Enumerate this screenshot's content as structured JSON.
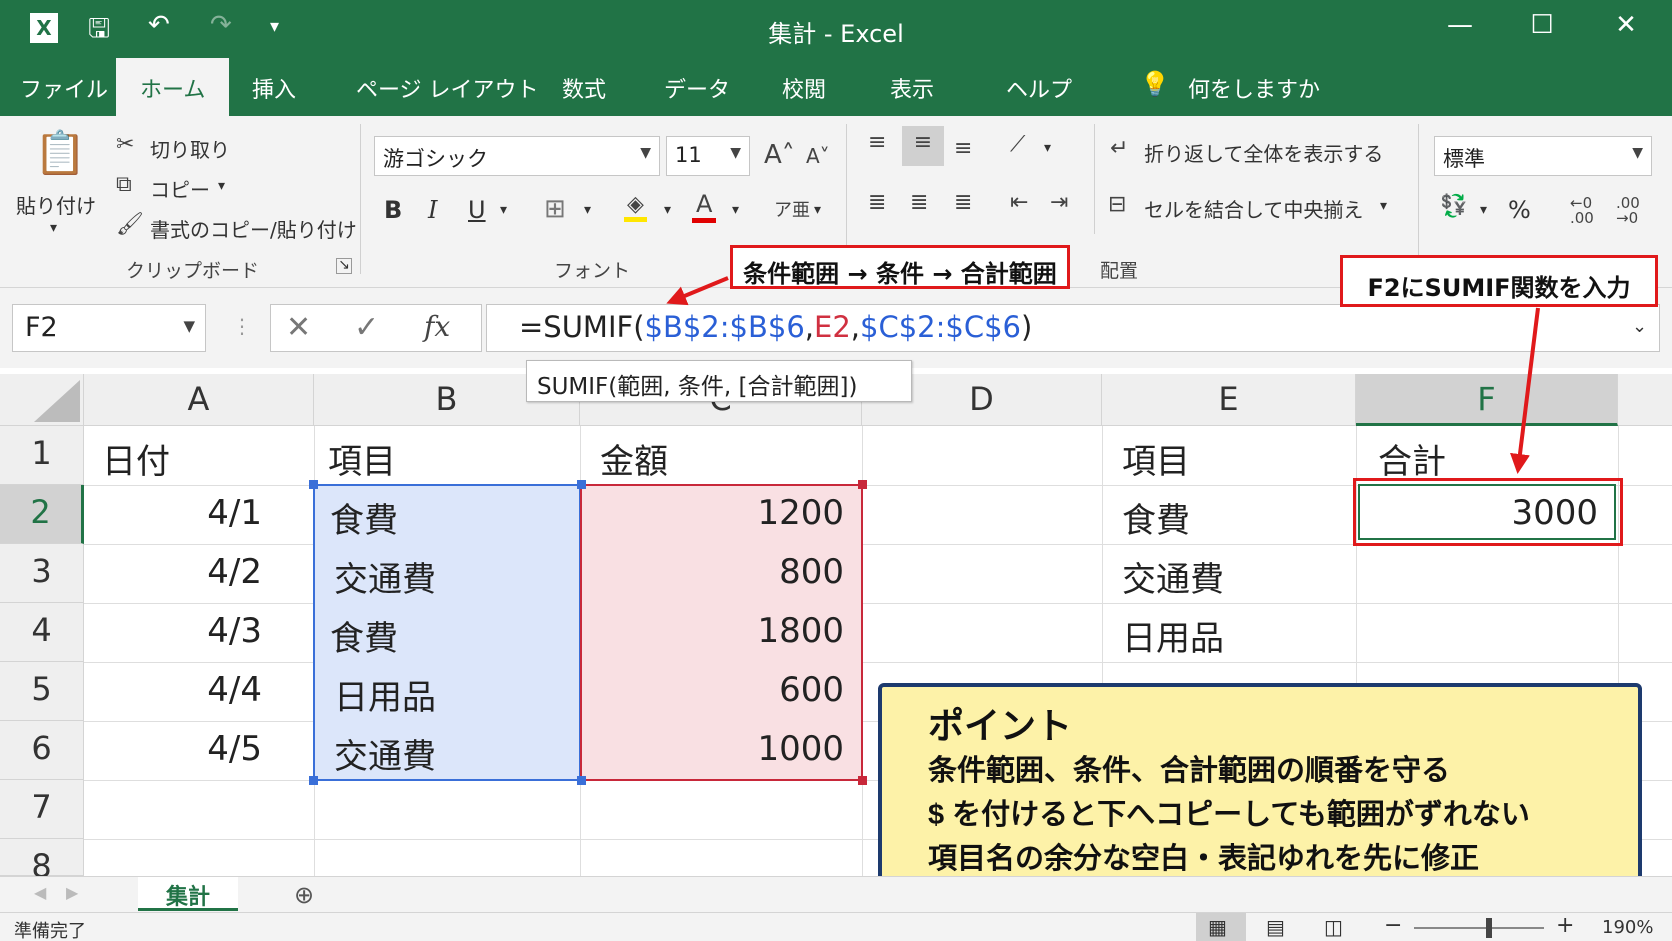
{
  "window": {
    "title": "集計 - Excel",
    "qat": {
      "save_icon": "save-icon",
      "undo_icon": "undo-icon",
      "redo_icon": "redo-icon"
    }
  },
  "tabs": [
    "ファイル",
    "ホーム",
    "挿入",
    "ページ レイアウト",
    "数式",
    "データ",
    "校閲",
    "表示",
    "ヘルプ",
    "何をしますか"
  ],
  "ribbon": {
    "clipboard": {
      "paste": "貼り付け",
      "cut": "切り取り",
      "copy": "コピー",
      "format_painter": "書式のコピー/貼り付け",
      "label": "クリップボード"
    },
    "font": {
      "name": "游ゴシック",
      "size": "11",
      "bold": "B",
      "italic": "I",
      "underline": "U",
      "label": "フォント"
    },
    "alignment": {
      "wrap": "折り返して全体を表示する",
      "merge": "セルを結合して中央揃え",
      "label": "配置"
    },
    "number": {
      "format": "標準",
      "percent": "%"
    }
  },
  "formula_bar": {
    "name_box": "F2",
    "fx": "fx",
    "formula_prefix": "=SUMIF(",
    "arg1": "$B$2:$B$6",
    "comma1": ",",
    "arg2": "E2",
    "comma2": ",",
    "arg3": "$C$2:$C$6",
    "suffix": ")",
    "tooltip": "SUMIF(範囲, 条件, [合計範囲])"
  },
  "columns": [
    "A",
    "B",
    "C",
    "D",
    "E",
    "F"
  ],
  "rows": [
    "1",
    "2",
    "3",
    "4",
    "5",
    "6",
    "7",
    "8"
  ],
  "cells": {
    "A1": "日付",
    "B1": "項目",
    "C1": "金額",
    "E1": "項目",
    "F1": "合計",
    "A2": "4/1",
    "B2": "食費",
    "C2": "1200",
    "E2": "食費",
    "F2": "3000",
    "A3": "4/2",
    "B3": "交通費",
    "C3": "800",
    "E3": "交通費",
    "A4": "4/3",
    "B4": "食費",
    "C4": "1800",
    "E4": "日用品",
    "A5": "4/4",
    "B5": "日用品",
    "C5": "600",
    "A6": "4/5",
    "B6": "交通費",
    "C6": "1000"
  },
  "annotations": {
    "order_label": "条件範囲 → 条件 → 合計範囲",
    "input_label": "F2にSUMIF関数を入力",
    "point_title": "ポイント",
    "point_1": "条件範囲、条件、合計範囲の順番を守る",
    "point_2": "$ を付けると下へコピーしても範囲がずれない",
    "point_3": "項目名の余分な空白・表記ゆれを先に修正"
  },
  "sheet_tab": "集計",
  "status": {
    "ready": "準備完了",
    "zoom": "190%"
  }
}
